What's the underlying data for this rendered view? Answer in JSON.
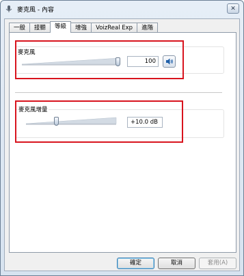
{
  "window": {
    "title": "麥克風 - 內容",
    "close_symbol": "✕"
  },
  "tabs": [
    {
      "label": "一般"
    },
    {
      "label": "接聽"
    },
    {
      "label": "等級"
    },
    {
      "label": "增強"
    },
    {
      "label": "VoizReal Exp"
    },
    {
      "label": "進階"
    }
  ],
  "active_tab": "等級",
  "microphone": {
    "label": "麥克風",
    "value": "100",
    "level": 1.0
  },
  "boost": {
    "label": "麥克風增量",
    "value": "+10.0 dB",
    "level": 0.33
  },
  "buttons": {
    "ok": "確定",
    "cancel": "取消",
    "apply": "套用(A)"
  },
  "colors": {
    "highlight_box": "#d8131d",
    "accent": "#3c7fb1"
  }
}
